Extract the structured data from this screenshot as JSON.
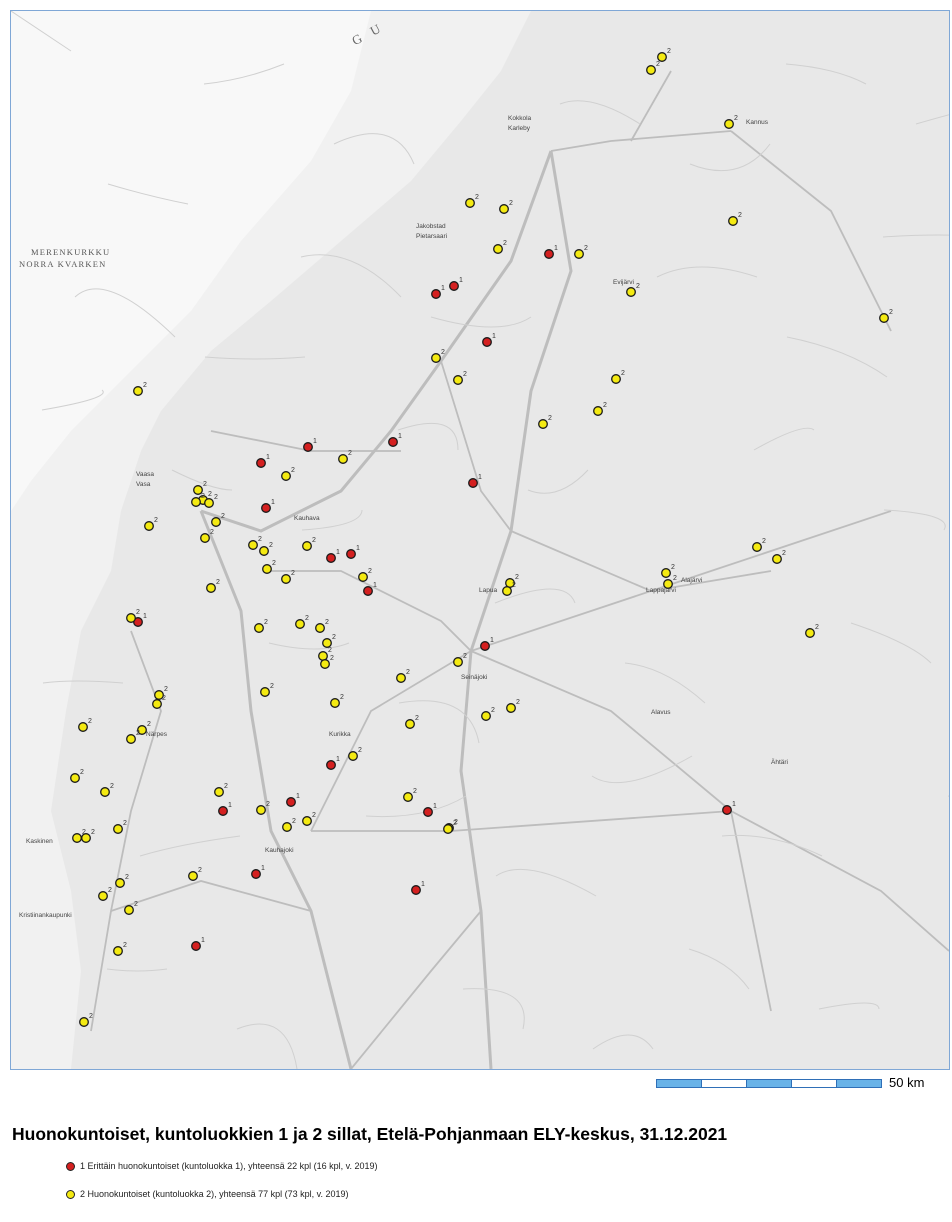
{
  "map": {
    "sea_labels": {
      "merenkurkku": "MERENKURKKU",
      "norra_kvarken": "NORRA KVARKEN",
      "gulf": "G U"
    },
    "places": [
      "Kokkola",
      "Karleby",
      "Vaasa",
      "Vasa",
      "Seinäjoki",
      "Kauhava",
      "Lapua",
      "Kurikka",
      "Kauhajoki",
      "Alajärvi",
      "Kristiinankaupunki",
      "Lappajärvi",
      "Ähtäri",
      "Alavus",
      "Kannus",
      "Evijärvi",
      "Jakobstad",
      "Pietarsaari",
      "Närpes",
      "Kaskinen"
    ],
    "scale_label": "50 km",
    "colors": {
      "class1": "#d42020",
      "class2": "#f4ea12",
      "roads": "#bdbdbd",
      "background": "#f1f1f1",
      "frame": "#7fa7d6",
      "scale": "#69b3e8"
    },
    "bridges_class1_count_shown": 22,
    "bridges_class2_count_shown": 77,
    "bridge_labels": [
      "1",
      "2"
    ]
  },
  "title": "Huonokuntoiset, kuntoluokkien 1 ja 2 sillat, Etelä-Pohjanmaan ELY-keskus, 31.12.2021",
  "legend": {
    "item1_label": "1 Erittäin huonokuntoiset (kuntoluokka 1), yhteensä 22 kpl (16 kpl, v. 2019)",
    "item2_label": "2 Huonokuntoiset (kuntoluokka 2), yhteensä 77 kpl (73 kpl, v. 2019)"
  }
}
